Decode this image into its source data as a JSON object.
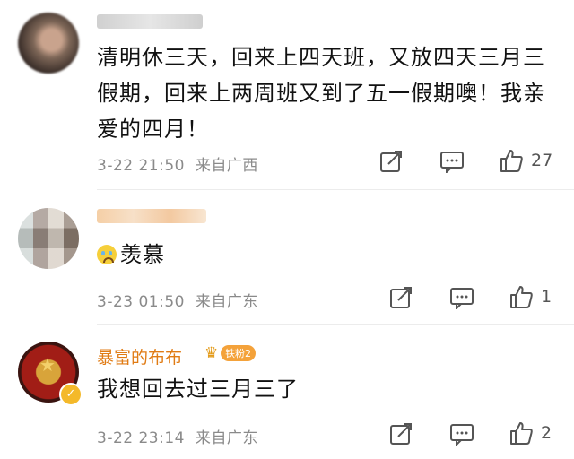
{
  "comments": [
    {
      "text": "清明休三天，回来上四天班，又放四天三月三假期，回来上两周班又到了五一假期噢！我亲爱的四月！",
      "time": "3-22 21:50",
      "location": "来自广西",
      "likes": "27"
    },
    {
      "text": "羡慕",
      "time": "3-23 01:50",
      "location": "来自广东",
      "likes": "1"
    },
    {
      "username": "暴富的布布",
      "fan_badge": "铁粉2",
      "text": "我想回去过三月三了",
      "time": "3-22 23:14",
      "location": "来自广东",
      "likes": "2"
    }
  ],
  "icons": {
    "share": "share-icon",
    "comment": "comment-icon",
    "like": "like-icon",
    "verified": "verified-badge-icon"
  },
  "colors": {
    "username": "#e07b14",
    "badge": "#f4a23a"
  }
}
